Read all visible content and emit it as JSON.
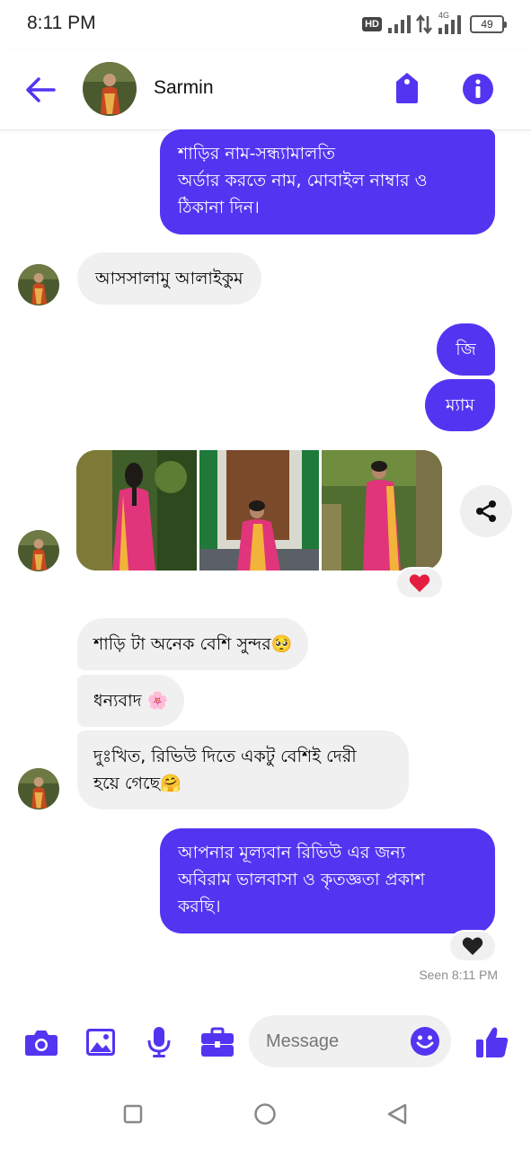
{
  "status_bar": {
    "time": "8:11 PM",
    "hd": "HD",
    "network": "4G",
    "battery": "49"
  },
  "header": {
    "contact_name": "Sarmin"
  },
  "messages": {
    "m1": {
      "line1": "শাড়ির নাম-সন্ধ্যামালতি",
      "line2": "অর্ডার করতে নাম, মোবাইল নাম্বার ও",
      "line3": "ঠিকানা দিন।"
    },
    "m2": "আসসালামু আলাইকুম",
    "m3": "জি",
    "m4": "ম্যাম",
    "m6": "শাড়ি টা অনেক বেশি সুন্দর🥺",
    "m7": "ধন্যবাদ 🌸",
    "m8": {
      "line1": "দুঃখিত, রিভিউ দিতে একটু বেশিই দেরী",
      "line2": "হয়ে গেছে🤗"
    },
    "m9": {
      "line1": "আপনার মূল্যবান রিভিউ এর জন্য",
      "line2": "অবিরাম ভালবাসা ও কৃতজ্ঞতা প্রকাশ",
      "line3": "করছি।"
    }
  },
  "reactions": {
    "photos": "heart",
    "last_message": "black-heart"
  },
  "seen_status": "Seen 8:11 PM",
  "composer": {
    "placeholder": "Message"
  },
  "colors": {
    "accent": "#5335f1",
    "incoming_bubble": "#f0f0f0",
    "heart": "#e41e3f"
  },
  "icons": [
    "arrow-left-icon",
    "tag-icon",
    "info-icon",
    "share-icon",
    "camera-icon",
    "image-icon",
    "microphone-icon",
    "briefcase-icon",
    "smiley-icon",
    "thumbs-up-icon",
    "square-icon",
    "circle-icon",
    "triangle-back-icon"
  ]
}
